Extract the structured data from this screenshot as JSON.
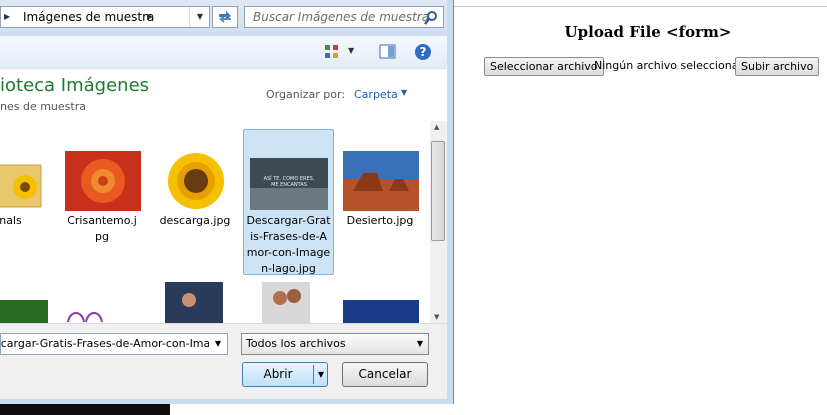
{
  "dialog": {
    "address": {
      "crumb": "Imágenes de muestra"
    },
    "search": {
      "placeholder": "Buscar Imágenes de muestra"
    },
    "library": {
      "title": "ioteca Imágenes",
      "subtitle": "nes de muestra"
    },
    "organize": {
      "label": "Organizar por:",
      "value": "Carpeta"
    },
    "files": [
      {
        "label": "iginals"
      },
      {
        "label": "Crisantemo.jpg"
      },
      {
        "label": "descarga.jpg"
      },
      {
        "label": "Descargar-Gratis-Frases-de-Amor-con-Imagen-lago.jpg",
        "selected": true
      },
      {
        "label": "Desierto.jpg"
      }
    ],
    "thumb_text": {
      "line1": "ASÍ TE, COMO ERES,",
      "line2": "ME ENCANTAS"
    },
    "filename": {
      "value": "scargar-Gratis-Frases-de-Amor-con-Imag"
    },
    "filter": {
      "value": "Todos los archivos"
    },
    "buttons": {
      "open": "Abrir",
      "cancel": "Cancelar"
    }
  },
  "webpage": {
    "title": "Upload File <form>",
    "choose_button": "Seleccionar archivo",
    "status": "Ningún archivo seleccionado",
    "submit_button": "Subir archivo"
  },
  "colors": {
    "library_title": "#1e7a2e",
    "link": "#1e5fb4",
    "selection": "#cde4f7"
  }
}
